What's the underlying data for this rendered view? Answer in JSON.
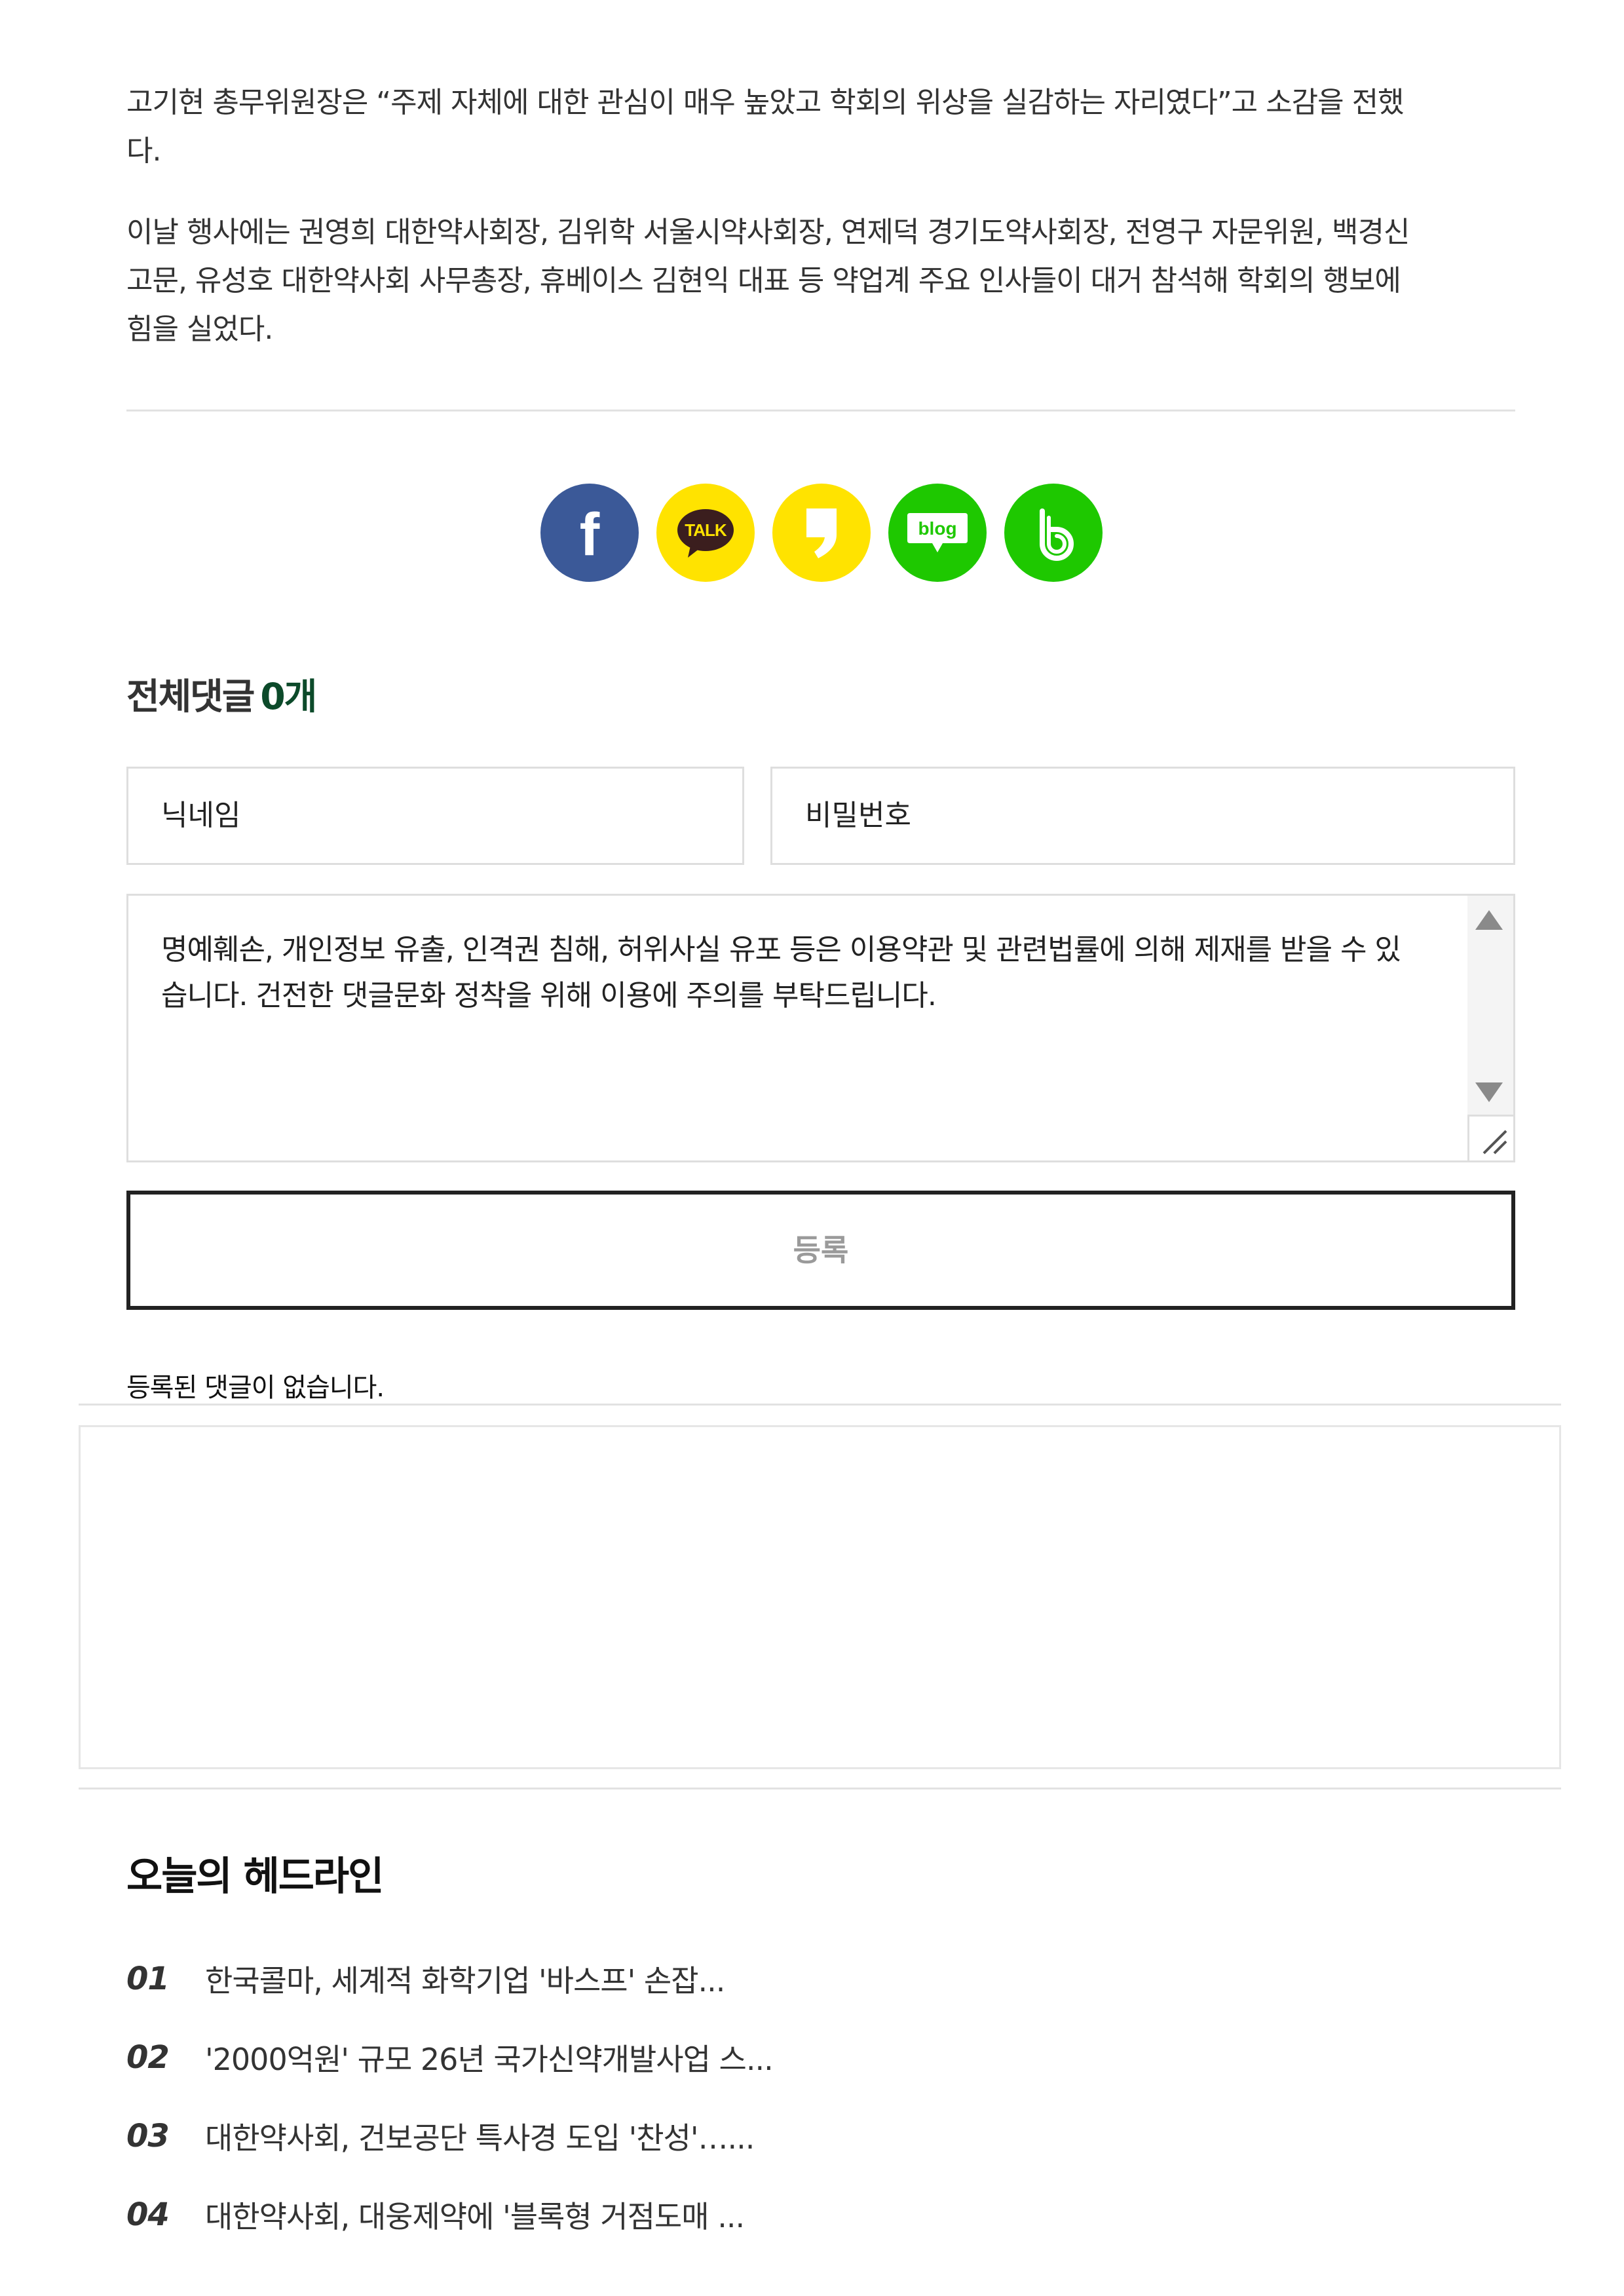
{
  "article": {
    "paragraphs": [
      {
        "lines": [
          "고기현 총무위원장은 “주제 자체에 대한 관심이 매우 높았고 학회의 위상을 실감하는 자리였다”고 소감을 전했",
          "다."
        ]
      },
      {
        "lines": [
          "이날 행사에는 권영희 대한약사회장, 김위학 서울시약사회장, 연제덕 경기도약사회장, 전영구 자문위원, 백경신",
          "고문, 유성호 대한약사회 사무총장, 휴베이스 김현익 대표 등 약업계 주요 인사들이 대거 참석해 학회의 행보에",
          "힘을 실었다."
        ]
      }
    ]
  },
  "share": {
    "buttons": [
      {
        "name": "facebook",
        "icon": "facebook-icon",
        "label": "f",
        "color": "#3b5998"
      },
      {
        "name": "kakaotalk",
        "icon": "kakaotalk-icon",
        "label": "TALK",
        "color": "#ffe300"
      },
      {
        "name": "kakaostory",
        "icon": "kakaostory-icon",
        "label": "",
        "color": "#ffe300"
      },
      {
        "name": "naver-blog",
        "icon": "naver-blog-icon",
        "label": "blog",
        "color": "#1ec800"
      },
      {
        "name": "band",
        "icon": "band-icon",
        "label": "b",
        "color": "#1ec800"
      }
    ]
  },
  "comments": {
    "title": "전체댓글",
    "count": "0개",
    "nickname_placeholder": "닉네임",
    "password_placeholder": "비밀번호",
    "textarea_placeholder": "명예훼손, 개인정보 유출, 인격권 침해, 허위사실 유포 등은 이용약관 및 관련법률에 의해 제재를 받을 수 있습니다. 건전한 댓글문화 정착을 위해 이용에 주의를 부탁드립니다.",
    "submit_label": "등록",
    "empty_message": "등록된 댓글이 없습니다."
  },
  "headlines": {
    "title": "오늘의 헤드라인",
    "items": [
      {
        "num": "01",
        "text": "한국콜마, 세계적 화학기업 '바스프' 손잡..."
      },
      {
        "num": "02",
        "text": "'2000억원' 규모 26년 국가신약개발사업 스..."
      },
      {
        "num": "03",
        "text": "대한약사회, 건보공단 특사경 도입 '찬성'…..."
      },
      {
        "num": "04",
        "text": "대한약사회, 대웅제약에 '블록형 거점도매 ..."
      }
    ]
  }
}
